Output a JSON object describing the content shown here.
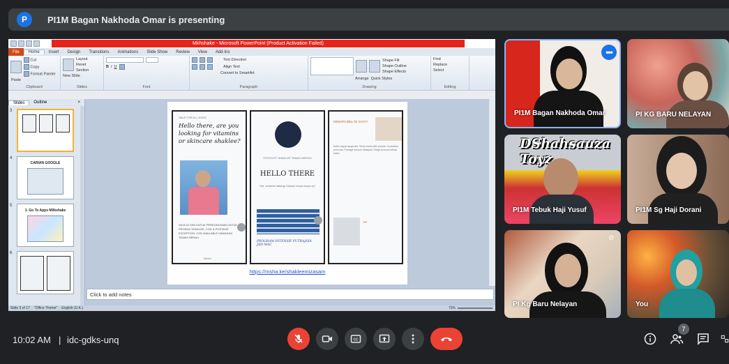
{
  "meeting": {
    "presenting_banner": "PI1M Bagan Nakhoda Omar is presenting",
    "time": "10:02 AM",
    "separator": "|",
    "code": "idc-gdks-unq",
    "participant_count": "7"
  },
  "powerpoint": {
    "title": "Mkhshake - Microsoft PowerPoint (Product Activation Failed)",
    "menu_tabs": [
      "File",
      "Home",
      "Insert",
      "Design",
      "Transitions",
      "Animations",
      "Slide Show",
      "Review",
      "View",
      "Add-Ins"
    ],
    "ribbon": {
      "clipboard": {
        "cut": "Cut",
        "copy": "Copy",
        "format_painter": "Format Painter",
        "paste": "Paste",
        "label": "Clipboard"
      },
      "slides": {
        "new_slide": "New Slide",
        "layout": "Layout",
        "reset": "Reset",
        "section": "Section",
        "label": "Slides"
      },
      "font_label": "Font",
      "paragraph": {
        "text_direction": "Text Direction",
        "align_text": "Align Text",
        "smartart": "Convert to SmartArt",
        "label": "Paragraph"
      },
      "drawing": {
        "arrange": "Arrange",
        "quick_styles": "Quick Styles",
        "shape_fill": "Shape Fill",
        "shape_outline": "Shape Outline",
        "shape_effects": "Shape Effects",
        "label": "Drawing"
      },
      "editing": {
        "find": "Find",
        "replace": "Replace",
        "select": "Select",
        "label": "Editing"
      }
    },
    "pane_tabs": {
      "slides": "Slides",
      "outline": "Outline",
      "close": "×"
    },
    "thumbnails": [
      {
        "num": "3",
        "caption": ""
      },
      {
        "num": "4",
        "caption": "CARIAN GOOGLE"
      },
      {
        "num": "5",
        "caption": "1. Go To Apps Milkshake"
      },
      {
        "num": "6",
        "caption": ""
      }
    ],
    "slide": {
      "panel1_small": "SALE FOR ALL AGES",
      "panel1_heading": "Hello there, are you looking for vitamins or skincare shaklee?",
      "panel1_text": "SAYA DI SINI UNTUK PERKONGSIAN UNTUK PRODUK SHAKLEE. COD & POSTAGE EXCEPTION. COD AVAILABLE KAWASAN TANAH MERAH.",
      "panel1_sign": "Mizan",
      "panel2_small": "STOCKIST SHAKLEE TANAH MERAH",
      "panel2_hello": "HELLO THERE",
      "panel2_sub": "Hai, selamat datang! Silakan tanya-tanya ya!",
      "panel2_program": "PROGRAM INTENSIF PUTRAJAYA JAN-MAC",
      "panel3_title": "KENAPA BELI DI SAYA?",
      "panel3_lines": "Boleh dapat harga ahli. Sedia bantu pilih produk. Konsultasi percuma. Postage seluruh Malaysia. Harga promosi setiap bulan.",
      "panel3_tip": "TIP",
      "link": "https://msha.ke/shakleemizasam"
    },
    "notes_placeholder": "Click to add notes",
    "status": {
      "slide": "Slide 3 of 17",
      "theme": "\"Office Theme\"",
      "lang": "English (U.K.)",
      "zoom": "73%"
    }
  },
  "participants": [
    {
      "name": "PI1M Bagan Nakhoda Omar",
      "active": true
    },
    {
      "name": "PI KG BARU NELAYAN",
      "active": false
    },
    {
      "name": "PI1M Tebuk Haji Yusuf",
      "overlay": "DShahsauza Toyz",
      "active": false
    },
    {
      "name": "PI1M Sg Haji Dorani",
      "active": false
    },
    {
      "name": "PI Kg Baru Nelayan",
      "active": false
    },
    {
      "name": "You",
      "active": false
    }
  ],
  "colors": {
    "accent": "#1a73e8",
    "end_call": "#ea4335",
    "bg": "#202124",
    "control": "#3c4043"
  }
}
